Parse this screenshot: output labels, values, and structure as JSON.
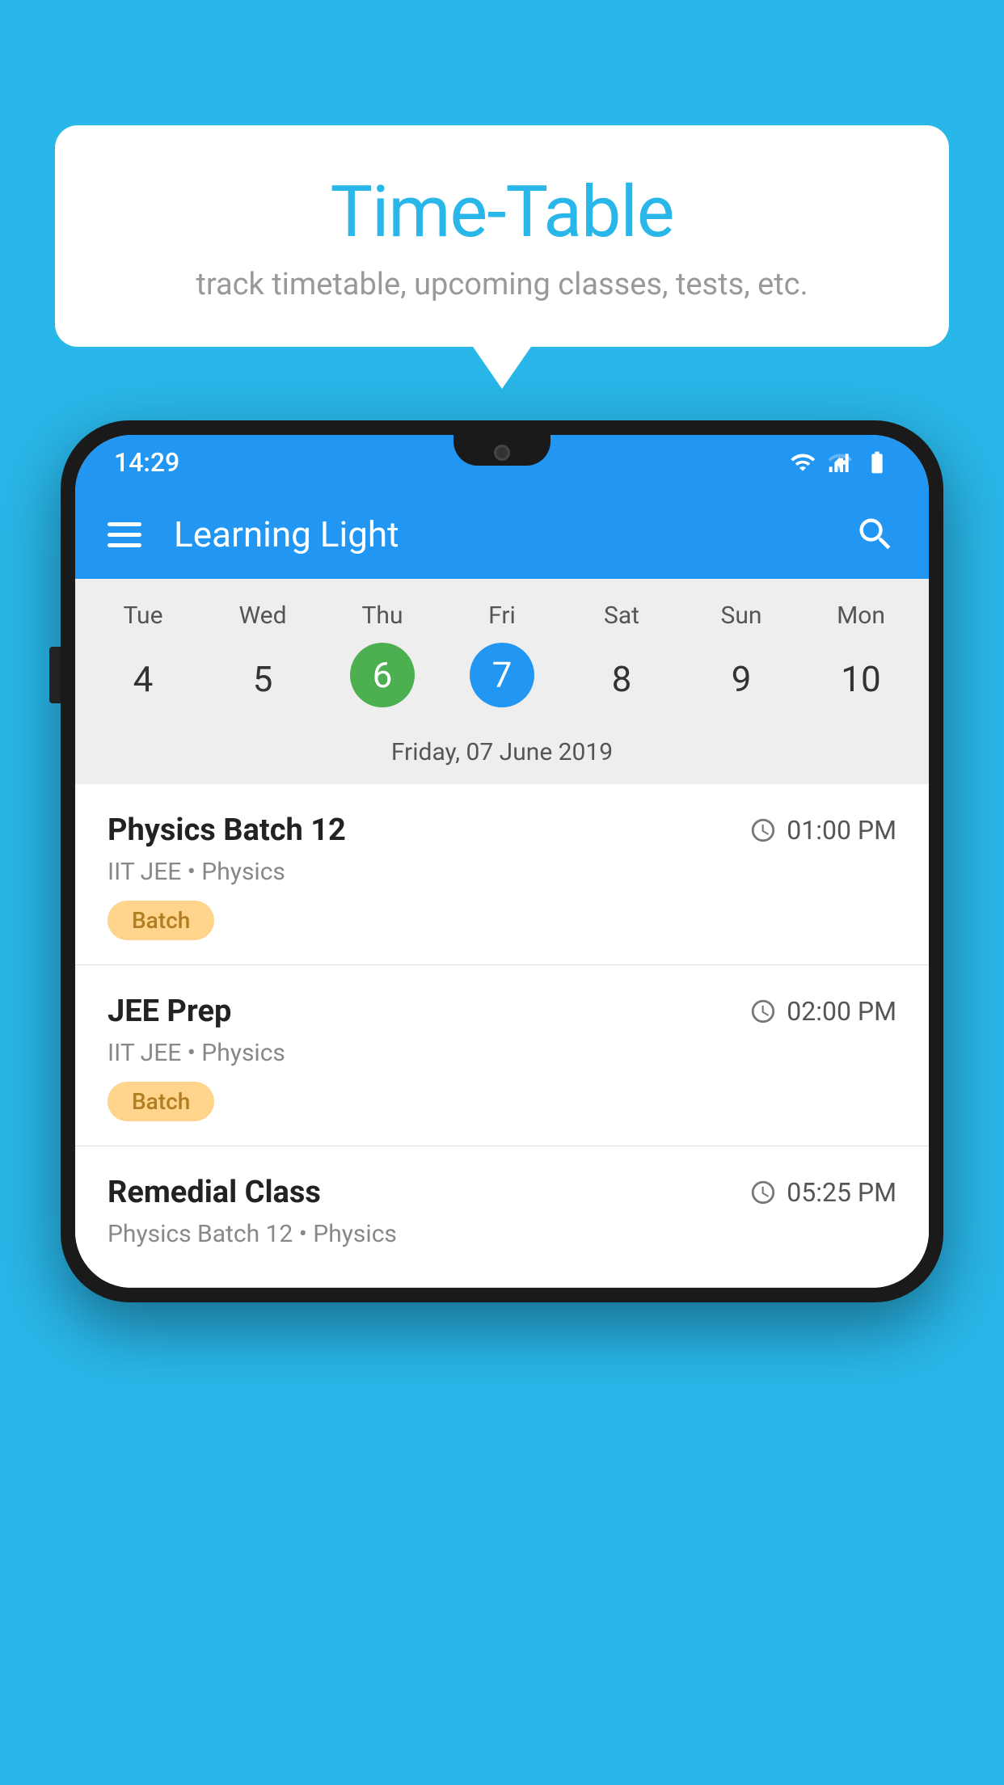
{
  "background_color": "#29b6e8",
  "bubble": {
    "title": "Time-Table",
    "subtitle": "track timetable, upcoming classes, tests, etc."
  },
  "phone": {
    "status_bar": {
      "time": "14:29",
      "icons": [
        "wifi",
        "signal",
        "battery"
      ]
    },
    "app_bar": {
      "title": "Learning Light"
    },
    "calendar": {
      "days": [
        "Tue",
        "Wed",
        "Thu",
        "Fri",
        "Sat",
        "Sun",
        "Mon"
      ],
      "dates": [
        "4",
        "5",
        "6",
        "7",
        "8",
        "9",
        "10"
      ],
      "today_index": 2,
      "selected_index": 3,
      "selected_date_label": "Friday, 07 June 2019"
    },
    "schedule": [
      {
        "title": "Physics Batch 12",
        "time": "01:00 PM",
        "subtitle": "IIT JEE • Physics",
        "badge": "Batch"
      },
      {
        "title": "JEE Prep",
        "time": "02:00 PM",
        "subtitle": "IIT JEE • Physics",
        "badge": "Batch"
      },
      {
        "title": "Remedial Class",
        "time": "05:25 PM",
        "subtitle": "Physics Batch 12 • Physics",
        "badge": null
      }
    ]
  }
}
